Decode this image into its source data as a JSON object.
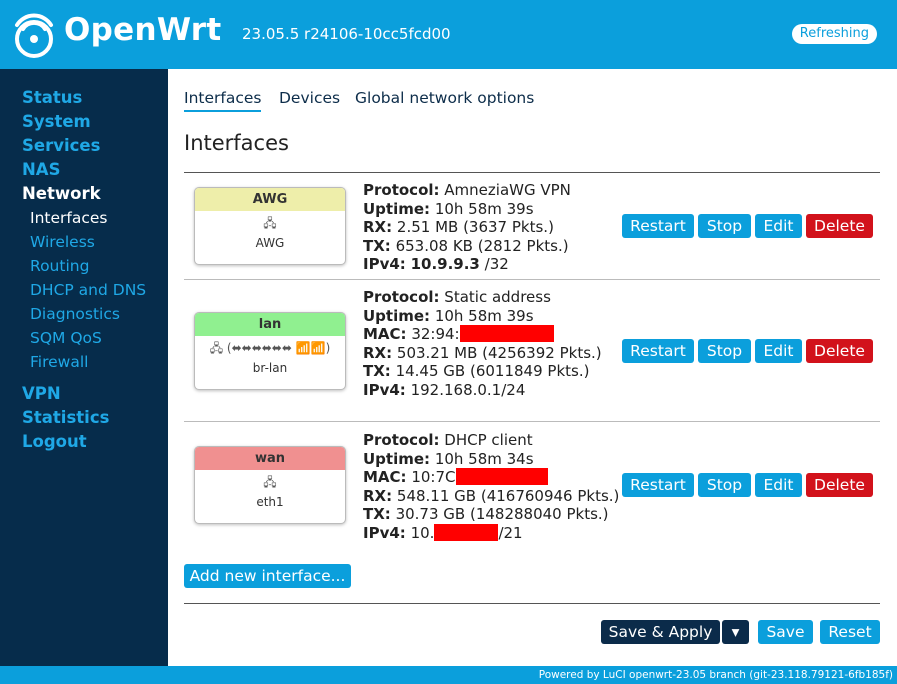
{
  "header": {
    "brand": "OpenWrt",
    "version": "23.05.5 r24106-10cc5fcd00",
    "refresh_label": "Refreshing"
  },
  "sidebar": {
    "top": [
      "Status",
      "System",
      "Services",
      "NAS",
      "Network"
    ],
    "network_sub": [
      "Interfaces",
      "Wireless",
      "Routing",
      "DHCP and DNS",
      "Diagnostics",
      "SQM QoS",
      "Firewall"
    ],
    "bottom": [
      "VPN",
      "Statistics",
      "Logout"
    ]
  },
  "tabs": [
    "Interfaces",
    "Devices",
    "Global network options"
  ],
  "page_title": "Interfaces",
  "interfaces": [
    {
      "name": "AWG",
      "color": "#eeeeaa",
      "device": "AWG",
      "protocol_label": "Protocol:",
      "protocol": "AmneziaWG VPN",
      "uptime_label": "Uptime:",
      "uptime": "10h 58m 39s",
      "rx_label": "RX:",
      "rx": "2.51 MB (3637 Pkts.)",
      "tx_label": "TX:",
      "tx": "653.08 KB (2812 Pkts.)",
      "ipv4_label": "IPv4:",
      "ipv4_addr": "10.9.9.3",
      "ipv4_mask": "/32"
    },
    {
      "name": "lan",
      "color": "#90f090",
      "device": "br-lan",
      "protocol_label": "Protocol:",
      "protocol": "Static address",
      "uptime_label": "Uptime:",
      "uptime": "10h 58m 39s",
      "mac_label": "MAC:",
      "mac": "32:94:",
      "rx_label": "RX:",
      "rx": "503.21 MB (4256392 Pkts.)",
      "tx_label": "TX:",
      "tx": "14.45 GB (6011849 Pkts.)",
      "ipv4_label": "IPv4:",
      "ipv4": "192.168.0.1/24"
    },
    {
      "name": "wan",
      "color": "#f09090",
      "device": "eth1",
      "protocol_label": "Protocol:",
      "protocol": "DHCP client",
      "uptime_label": "Uptime:",
      "uptime": "10h 58m 34s",
      "mac_label": "MAC:",
      "mac": "10:7C",
      "rx_label": "RX:",
      "rx": "548.11 GB (416760946 Pkts.)",
      "tx_label": "TX:",
      "tx": "30.73 GB (148288040 Pkts.)",
      "ipv4_label": "IPv4:",
      "ipv4_prefix": "10.",
      "ipv4_mask": "/21"
    }
  ],
  "row_buttons": {
    "restart": "Restart",
    "stop": "Stop",
    "edit": "Edit",
    "delete": "Delete"
  },
  "add_interface_label": "Add new interface...",
  "actions": {
    "save_apply": "Save & Apply",
    "dropdown": "▾",
    "save": "Save",
    "reset": "Reset"
  },
  "footer": "Powered by LuCI openwrt-23.05 branch (git-23.118.79121-6fb185f)",
  "colors": {
    "accent": "#0b9fdc",
    "sidebar": "#062c4b",
    "danger": "#d2121b",
    "redaction": "#ff0000"
  }
}
